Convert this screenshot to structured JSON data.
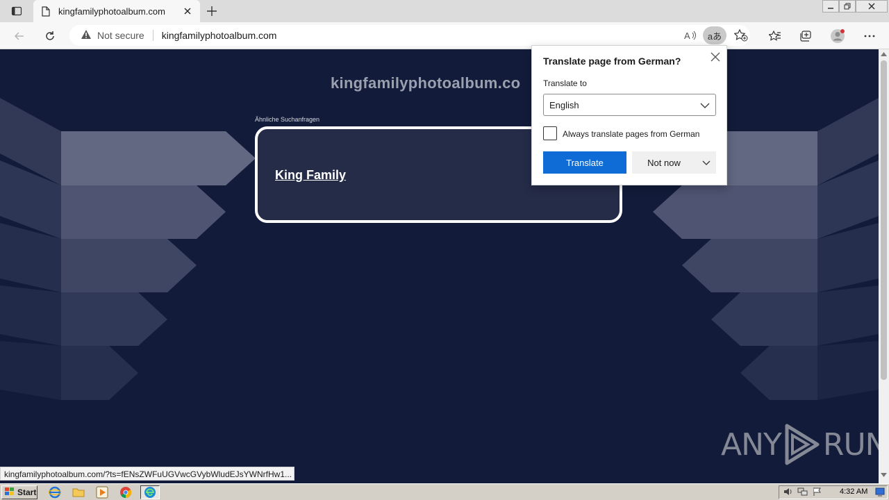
{
  "browser": {
    "tab_title": "kingfamilyphotoalbum.com",
    "address": {
      "security_label": "Not secure",
      "url": "kingfamilyphotoalbum.com"
    },
    "translate_icon_label": "aあ",
    "status_url": "kingfamilyphotoalbum.com/?ts=fENsZWFuUGVwcGVybWludEJsYWNrfHw1..."
  },
  "page": {
    "site_title": "kingfamilyphotoalbum.co",
    "related_label": "Ähnliche Suchanfragen",
    "result_link": "King Family",
    "watermark_left": "ANY",
    "watermark_right": "RUN"
  },
  "translate_popup": {
    "title": "Translate page from German?",
    "translate_to_label": "Translate to",
    "language": "English",
    "always_label": "Always translate pages from German",
    "always_checked": false,
    "translate_button": "Translate",
    "not_now_button": "Not now"
  },
  "taskbar": {
    "start_label": "Start",
    "clock": "4:32 AM"
  },
  "colors": {
    "page_bg": "#121c3a",
    "accent": "#0f6cd6"
  }
}
